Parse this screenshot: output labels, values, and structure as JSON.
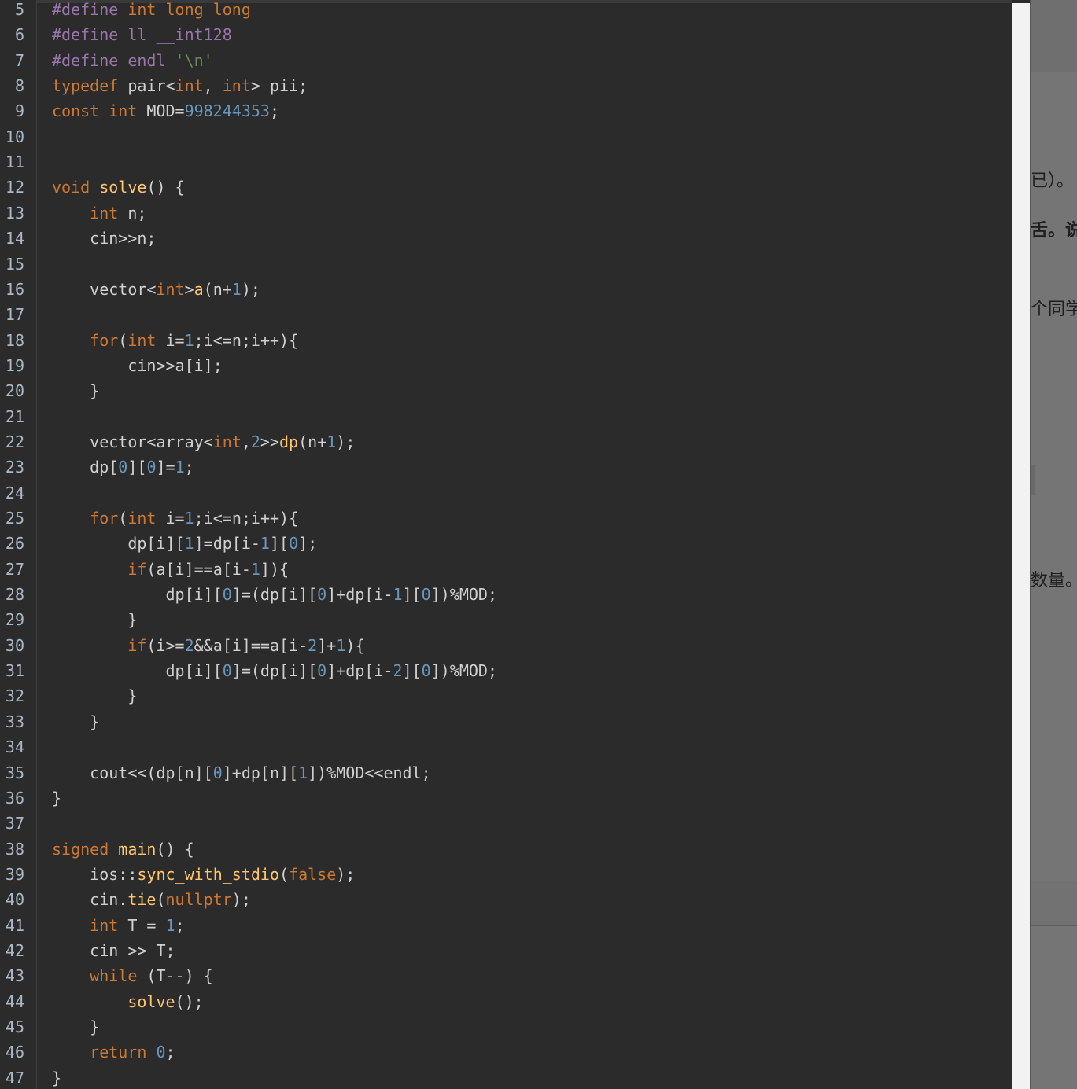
{
  "editor": {
    "lines": [
      {
        "n": "5",
        "t": [
          [
            "#define ",
            "mac"
          ],
          [
            "int long long",
            "macro"
          ]
        ]
      },
      {
        "n": "6",
        "t": [
          [
            "#define ll __int128",
            "mac"
          ]
        ]
      },
      {
        "n": "7",
        "t": [
          [
            "#define endl ",
            "mac"
          ],
          [
            "'\\n'",
            "str"
          ]
        ]
      },
      {
        "n": "8",
        "t": [
          [
            "typedef ",
            "kw"
          ],
          [
            "pair<",
            "p"
          ],
          [
            "int",
            "kw"
          ],
          [
            ", ",
            "p"
          ],
          [
            "int",
            "kw"
          ],
          [
            "> pii;",
            "p"
          ]
        ]
      },
      {
        "n": "9",
        "t": [
          [
            "const ",
            "kw"
          ],
          [
            "int ",
            "kw"
          ],
          [
            "MOD=",
            "p"
          ],
          [
            "998244353",
            "num"
          ],
          [
            ";",
            "p"
          ]
        ]
      },
      {
        "n": "10",
        "t": []
      },
      {
        "n": "11",
        "t": []
      },
      {
        "n": "12",
        "t": [
          [
            "void ",
            "kw"
          ],
          [
            "solve",
            "fn"
          ],
          [
            "() {",
            "p"
          ]
        ]
      },
      {
        "n": "13",
        "t": [
          [
            "    ",
            "p"
          ],
          [
            "int ",
            "kw"
          ],
          [
            "n;",
            "p"
          ]
        ]
      },
      {
        "n": "14",
        "t": [
          [
            "    cin>>n;",
            "p"
          ]
        ]
      },
      {
        "n": "15",
        "t": []
      },
      {
        "n": "16",
        "t": [
          [
            "    vector<",
            "p"
          ],
          [
            "int",
            "kw"
          ],
          [
            ">",
            "p"
          ],
          [
            "a",
            "fn"
          ],
          [
            "(n+",
            "p"
          ],
          [
            "1",
            "num"
          ],
          [
            ");",
            "p"
          ]
        ]
      },
      {
        "n": "17",
        "t": []
      },
      {
        "n": "18",
        "t": [
          [
            "    ",
            "p"
          ],
          [
            "for",
            "kw"
          ],
          [
            "(",
            "p"
          ],
          [
            "int ",
            "kw"
          ],
          [
            "i=",
            "p"
          ],
          [
            "1",
            "num"
          ],
          [
            ";i<=n;i++){",
            "p"
          ]
        ]
      },
      {
        "n": "19",
        "t": [
          [
            "        cin>>a[i];",
            "p"
          ]
        ]
      },
      {
        "n": "20",
        "t": [
          [
            "    }",
            "p"
          ]
        ]
      },
      {
        "n": "21",
        "t": []
      },
      {
        "n": "22",
        "t": [
          [
            "    vector<array<",
            "p"
          ],
          [
            "int",
            "kw"
          ],
          [
            ",",
            "p"
          ],
          [
            "2",
            "num"
          ],
          [
            ">>",
            "p"
          ],
          [
            "dp",
            "fn"
          ],
          [
            "(n+",
            "p"
          ],
          [
            "1",
            "num"
          ],
          [
            ");",
            "p"
          ]
        ]
      },
      {
        "n": "23",
        "t": [
          [
            "    dp[",
            "p"
          ],
          [
            "0",
            "num"
          ],
          [
            "][",
            "p"
          ],
          [
            "0",
            "num"
          ],
          [
            "]=",
            "p"
          ],
          [
            "1",
            "num"
          ],
          [
            ";",
            "p"
          ]
        ]
      },
      {
        "n": "24",
        "t": []
      },
      {
        "n": "25",
        "t": [
          [
            "    ",
            "p"
          ],
          [
            "for",
            "kw"
          ],
          [
            "(",
            "p"
          ],
          [
            "int ",
            "kw"
          ],
          [
            "i=",
            "p"
          ],
          [
            "1",
            "num"
          ],
          [
            ";i<=n;i++){",
            "p"
          ]
        ]
      },
      {
        "n": "26",
        "t": [
          [
            "        dp[i][",
            "p"
          ],
          [
            "1",
            "num"
          ],
          [
            "]=dp[i-",
            "p"
          ],
          [
            "1",
            "num"
          ],
          [
            "][",
            "p"
          ],
          [
            "0",
            "num"
          ],
          [
            "];",
            "p"
          ]
        ]
      },
      {
        "n": "27",
        "t": [
          [
            "        ",
            "p"
          ],
          [
            "if",
            "kw"
          ],
          [
            "(a[i]==a[i-",
            "p"
          ],
          [
            "1",
            "num"
          ],
          [
            "]){",
            "p"
          ]
        ]
      },
      {
        "n": "28",
        "t": [
          [
            "            dp[i][",
            "p"
          ],
          [
            "0",
            "num"
          ],
          [
            "]=(dp[i][",
            "p"
          ],
          [
            "0",
            "num"
          ],
          [
            "]+dp[i-",
            "p"
          ],
          [
            "1",
            "num"
          ],
          [
            "][",
            "p"
          ],
          [
            "0",
            "num"
          ],
          [
            "])%MOD;",
            "p"
          ]
        ]
      },
      {
        "n": "29",
        "t": [
          [
            "        }",
            "p"
          ]
        ]
      },
      {
        "n": "30",
        "t": [
          [
            "        ",
            "p"
          ],
          [
            "if",
            "kw"
          ],
          [
            "(i>=",
            "p"
          ],
          [
            "2",
            "num"
          ],
          [
            "&&a[i]==a[i-",
            "p"
          ],
          [
            "2",
            "num"
          ],
          [
            "]+",
            "p"
          ],
          [
            "1",
            "num"
          ],
          [
            "){",
            "p"
          ]
        ]
      },
      {
        "n": "31",
        "t": [
          [
            "            dp[i][",
            "p"
          ],
          [
            "0",
            "num"
          ],
          [
            "]=(dp[i][",
            "p"
          ],
          [
            "0",
            "num"
          ],
          [
            "]+dp[i-",
            "p"
          ],
          [
            "2",
            "num"
          ],
          [
            "][",
            "p"
          ],
          [
            "0",
            "num"
          ],
          [
            "])%MOD;",
            "p"
          ]
        ]
      },
      {
        "n": "32",
        "t": [
          [
            "        }",
            "p"
          ]
        ]
      },
      {
        "n": "33",
        "t": [
          [
            "    }",
            "p"
          ]
        ]
      },
      {
        "n": "34",
        "t": []
      },
      {
        "n": "35",
        "t": [
          [
            "    cout<<(dp[n][",
            "p"
          ],
          [
            "0",
            "num"
          ],
          [
            "]+dp[n][",
            "p"
          ],
          [
            "1",
            "num"
          ],
          [
            "])%MOD<<endl;",
            "p"
          ]
        ]
      },
      {
        "n": "36",
        "t": [
          [
            "}",
            "p"
          ]
        ]
      },
      {
        "n": "37",
        "t": []
      },
      {
        "n": "38",
        "t": [
          [
            "signed ",
            "kw"
          ],
          [
            "main",
            "fn"
          ],
          [
            "() {",
            "p"
          ]
        ]
      },
      {
        "n": "39",
        "t": [
          [
            "    ios::",
            "p"
          ],
          [
            "sync_with_stdio",
            "fn"
          ],
          [
            "(",
            "p"
          ],
          [
            "false",
            "kw"
          ],
          [
            ");",
            "p"
          ]
        ]
      },
      {
        "n": "40",
        "t": [
          [
            "    cin.",
            "p"
          ],
          [
            "tie",
            "fn"
          ],
          [
            "(",
            "p"
          ],
          [
            "nullptr",
            "kw"
          ],
          [
            ");",
            "p"
          ]
        ]
      },
      {
        "n": "41",
        "t": [
          [
            "    ",
            "p"
          ],
          [
            "int ",
            "kw"
          ],
          [
            "T = ",
            "p"
          ],
          [
            "1",
            "num"
          ],
          [
            ";",
            "p"
          ]
        ]
      },
      {
        "n": "42",
        "t": [
          [
            "    cin >> T;",
            "p"
          ]
        ]
      },
      {
        "n": "43",
        "t": [
          [
            "    ",
            "p"
          ],
          [
            "while ",
            "kw"
          ],
          [
            "(T--) {",
            "p"
          ]
        ]
      },
      {
        "n": "44",
        "t": [
          [
            "        ",
            "p"
          ],
          [
            "solve",
            "fn"
          ],
          [
            "();",
            "p"
          ]
        ]
      },
      {
        "n": "45",
        "t": [
          [
            "    }",
            "p"
          ]
        ]
      },
      {
        "n": "46",
        "t": [
          [
            "    ",
            "p"
          ],
          [
            "return ",
            "kw"
          ],
          [
            "0",
            "num"
          ],
          [
            ";",
            "p"
          ]
        ]
      },
      {
        "n": "47",
        "t": [
          [
            "}",
            "p"
          ]
        ]
      }
    ]
  },
  "right_panel": {
    "snippets": [
      "已）。",
      "舌。说",
      "个同学",
      "数量。"
    ]
  },
  "colors": {
    "kw": "#cc7832",
    "macro": "#cc7832",
    "mac": "#9876aa",
    "str": "#6a8759",
    "num": "#6897bb",
    "fn": "#ffc66d",
    "p": "#d0d0d0"
  }
}
